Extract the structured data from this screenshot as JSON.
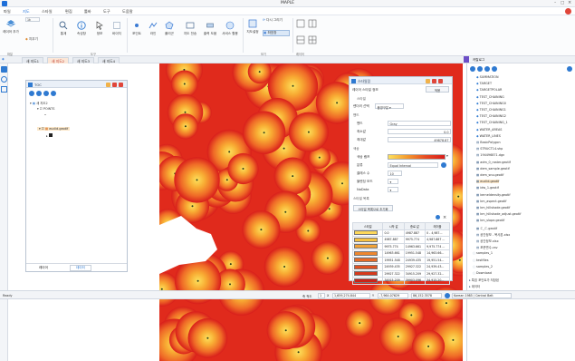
{
  "app": {
    "title": "MAPLE"
  },
  "menu": [
    "파일",
    "지도",
    "스타일",
    "편집",
    "툴바",
    "도구",
    "도움말"
  ],
  "ribbon": {
    "buttons": [
      "레이어 추가",
      "지우기",
      "",
      "통계",
      "속성창",
      "",
      "정보",
      "바이지",
      "포인트",
      "라인",
      "폴리곤",
      "지도 전송",
      "출력 도움",
      "서비스 활용",
      "",
      "다시 그리기",
      "좌표창",
      "지도설정",
      "공간분석"
    ],
    "zoom_value": "1k",
    "groups": [
      "파일",
      "도구",
      "",
      "보기",
      "레이어"
    ]
  },
  "tabs": [
    "새 지도1",
    "새 지도2",
    "새 지도3",
    "새 지도4"
  ],
  "toc": {
    "title": "TOC",
    "tree": [
      "새 지도2",
      "POINTS",
      "euclid.geotif"
    ],
    "bottom_tabs": [
      "레이어",
      "데이터"
    ]
  },
  "style_dialog": {
    "title": "스타일링",
    "layer_label": "레이어 스타일 정보",
    "apply_button": "적용",
    "tab_label": "스타일",
    "render_label": "렌더러 선택",
    "render_value": "음영구분",
    "section_band": "밴드",
    "band_label": "밴드",
    "band_value": "Gray",
    "min_label": "최소값",
    "min_value": "0.0",
    "max_label": "최대값",
    "max_value": "49878.87",
    "section_color": "색상",
    "ramp_label": "색상 램프",
    "class_label": "분류",
    "class_value": "Equal Interval",
    "count_label": "클래스 수",
    "count_value": "10",
    "blend_label": "블렌딩 모드",
    "nodata_label": "NoData",
    "section_spec": "스타일 목록",
    "reset_button": "스타일 목록으로 초기화",
    "table_headers": [
      "스타일",
      "시작 값",
      "종료 값",
      "레이블"
    ],
    "table_rows": [
      [
        "0.0",
        "4987.887",
        "0 - 4,987..."
      ],
      [
        "4987.887",
        "9975.774",
        "4,987.887 ..."
      ],
      [
        "9975.774",
        "14963.661",
        "9,975.774 ..."
      ],
      [
        "14963.661",
        "19951.548",
        "14,963.66..."
      ],
      [
        "19951.548",
        "24939.435",
        "19,951.54..."
      ],
      [
        "24939.435",
        "29927.322",
        "24,939.43..."
      ],
      [
        "29927.322",
        "34915.209",
        "29,927.32..."
      ],
      [
        "34915.209",
        "39903.096",
        "34,915.20..."
      ]
    ]
  },
  "right_panel": {
    "tab": "카탈로그",
    "tree": [
      "SUMMATION",
      "TARGET",
      "TARGETPOLAR",
      "TEST_CHAINING",
      "TEST_CHAINING0",
      "TEST_CHAINING1",
      "TEST_CHAINING2",
      "TEST_CHAINING_1",
      "WATER_AREAS",
      "WATER_LINES",
      "BasicPolygon",
      "STRUCT14.shp",
      "194496871.dgn",
      "adm_0_raster.geotif",
      "dem_sample.geotif",
      "dem_sno.geotif",
      "euclid.geotif",
      "idw_1.geotif",
      "kerneldensity.geotif",
      "km_aspect.geotif",
      "km_hillshade.geotif",
      "km_hillshade_adjust.geotif",
      "km_slope.geotif",
      "ㄷ_ㄷ.geotif",
      "공간정보 - 복사본.xlsx",
      "공간정보.xlsx",
      "포운변수.csv",
      "samples_1",
      "testfiles",
      "samples_2",
      "Download",
      "특징 포인트가 저장된",
      "데이터",
      "웹 서버"
    ]
  },
  "status": {
    "left": "Ready",
    "scale_label": "축 척도",
    "scale_value": "1",
    "x_label": "X",
    "x_value": "1,659,274.844",
    "y_label": "Y",
    "y_value": "-7,964.07629",
    "z_value": "86,152.3578",
    "crs": "Korean 1985 / Central Belt"
  },
  "colors": {
    "accent": "#1e6fd9",
    "heat_low": "#fde15c",
    "heat_high": "#d81d1b",
    "tab_active": "#fbe7d8",
    "close_red": "#e0463a"
  }
}
